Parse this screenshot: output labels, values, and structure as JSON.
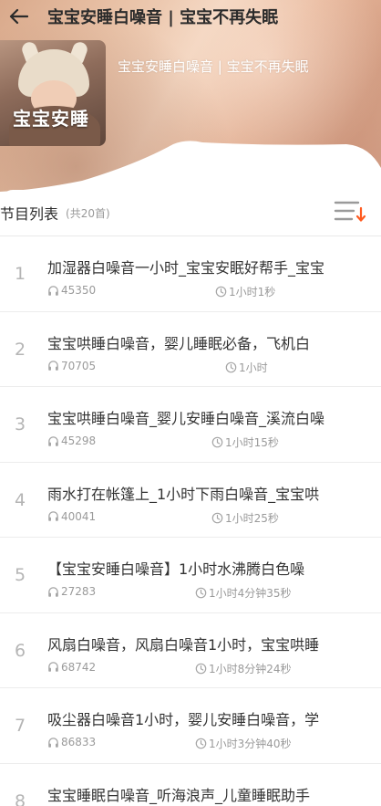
{
  "header": {
    "title": "宝宝安睡白噪音 | 宝宝不再失眠",
    "back_icon": "back-arrow-icon"
  },
  "album": {
    "cover_text": "宝宝安睡",
    "name": "宝宝安睡白噪音 | 宝宝不再失眠"
  },
  "list": {
    "title": "节目列表",
    "count": "(共20首)",
    "sort_icon": "sort-icon",
    "accent_color": "#ff5a1f"
  },
  "tracks": [
    {
      "index": "1",
      "title": "加湿器白噪音一小时_宝宝安眠好帮手_宝宝",
      "plays": "45350",
      "duration": "1小时1秒"
    },
    {
      "index": "2",
      "title": "宝宝哄睡白噪音，婴儿睡眠必备，飞机白",
      "plays": "70705",
      "duration": "1小时"
    },
    {
      "index": "3",
      "title": "宝宝哄睡白噪音_婴儿安睡白噪音_溪流白噪",
      "plays": "45298",
      "duration": "1小时15秒"
    },
    {
      "index": "4",
      "title": "雨水打在帐篷上_1小时下雨白噪音_宝宝哄",
      "plays": "40041",
      "duration": "1小时25秒"
    },
    {
      "index": "5",
      "title": "【宝宝安睡白噪音】1小时水沸腾白色噪",
      "plays": "27283",
      "duration": "1小时4分钟35秒"
    },
    {
      "index": "6",
      "title": "风扇白噪音，风扇白噪音1小时，宝宝哄睡",
      "plays": "68742",
      "duration": "1小时8分钟24秒"
    },
    {
      "index": "7",
      "title": "吸尘器白噪音1小时，婴儿安睡白噪音，学",
      "plays": "86833",
      "duration": "1小时3分钟40秒"
    },
    {
      "index": "8",
      "title": "宝宝睡眠白噪音_听海浪声_儿童睡眠助手",
      "plays": "",
      "duration": ""
    }
  ]
}
